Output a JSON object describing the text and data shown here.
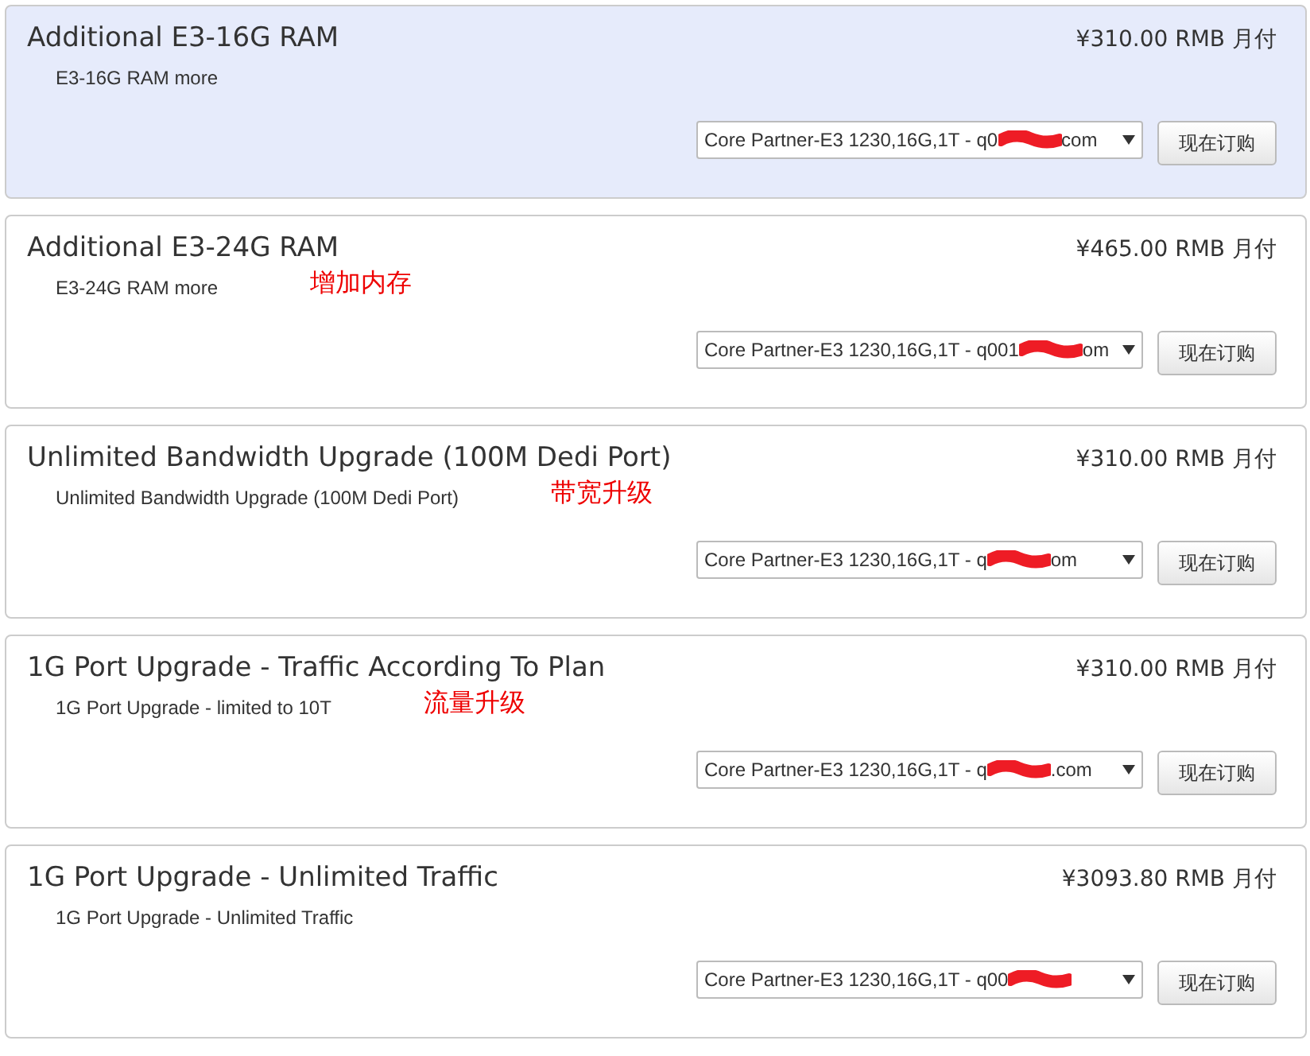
{
  "addons": [
    {
      "title": "Additional E3-16G RAM",
      "description": "E3-16G RAM more",
      "price": "¥310.00 RMB 月付",
      "selected": true,
      "select_prefix": "Core Partner-E3 1230,16G,1T - q0",
      "select_suffix": "com",
      "button": "现在订购"
    },
    {
      "title": "Additional E3-24G RAM",
      "description": "E3-24G RAM more",
      "note": "增加内存",
      "price": "¥465.00 RMB 月付",
      "selected": false,
      "select_prefix": "Core Partner-E3 1230,16G,1T - q001",
      "select_suffix": "om",
      "button": "现在订购"
    },
    {
      "title": "Unlimited Bandwidth Upgrade (100M Dedi Port)",
      "description": "Unlimited Bandwidth Upgrade (100M Dedi Port)",
      "note": "带宽升级",
      "price": "¥310.00 RMB 月付",
      "selected": false,
      "select_prefix": "Core Partner-E3 1230,16G,1T - q",
      "select_suffix": "om",
      "button": "现在订购"
    },
    {
      "title": "1G Port Upgrade - Traffic According To Plan",
      "description": "1G Port Upgrade - limited to 10T",
      "note": "流量升级",
      "price": "¥310.00 RMB 月付",
      "selected": false,
      "select_prefix": "Core Partner-E3 1230,16G,1T - q",
      "select_suffix": ".com",
      "button": "现在订购"
    },
    {
      "title": "1G Port Upgrade - Unlimited Traffic",
      "description": "1G Port Upgrade - Unlimited Traffic",
      "price": "¥3093.80 RMB 月付",
      "selected": false,
      "select_prefix": "Core Partner-E3 1230,16G,1T - q00",
      "button": "现在订购"
    }
  ]
}
